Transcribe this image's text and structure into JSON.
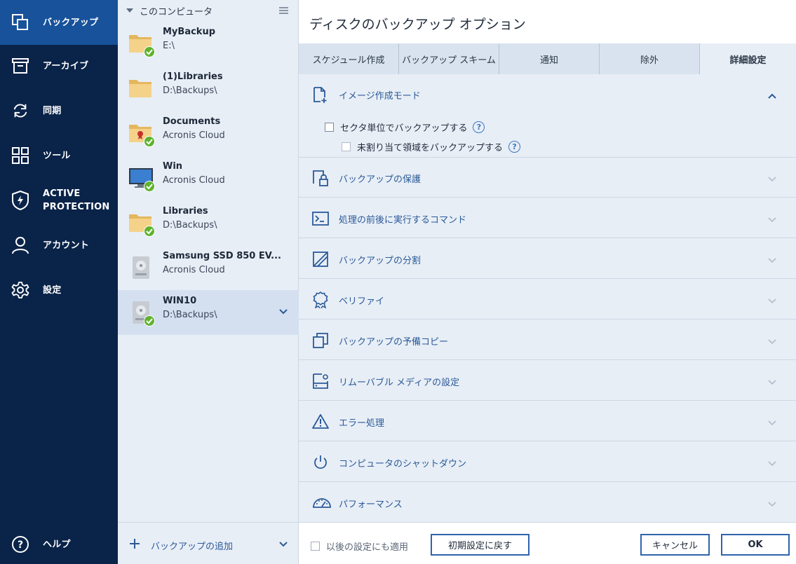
{
  "nav": {
    "items": [
      {
        "label": "バックアップ",
        "icon": "copy-icon"
      },
      {
        "label": "アーカイブ",
        "icon": "archive-icon"
      },
      {
        "label": "同期",
        "icon": "sync-icon"
      },
      {
        "label": "ツール",
        "icon": "tools-icon"
      },
      {
        "label": "ACTIVE PROTECTION",
        "icon": "shield-icon"
      },
      {
        "label": "アカウント",
        "icon": "account-icon"
      },
      {
        "label": "設定",
        "icon": "gear-icon"
      }
    ],
    "help_label": "ヘルプ",
    "accent": "#17529b",
    "background": "#0a2348"
  },
  "list": {
    "header": "このコンピュータ",
    "items": [
      {
        "name": "MyBackup",
        "sub": "E:\\",
        "type": "folder",
        "ok": true
      },
      {
        "name": "(1)Libraries",
        "sub": "D:\\Backups\\",
        "type": "folder",
        "ok": false
      },
      {
        "name": "Documents",
        "sub": "Acronis Cloud",
        "type": "folder-secure",
        "ok": true
      },
      {
        "name": "Win",
        "sub": "Acronis Cloud",
        "type": "monitor",
        "ok": true
      },
      {
        "name": "Libraries",
        "sub": "D:\\Backups\\",
        "type": "folder",
        "ok": true
      },
      {
        "name": "Samsung SSD 850 EV...",
        "sub": "Acronis Cloud",
        "type": "disk",
        "ok": false
      },
      {
        "name": "WIN10",
        "sub": "D:\\Backups\\",
        "type": "disk",
        "ok": true
      }
    ],
    "add_label": "バックアップの追加"
  },
  "pane": {
    "title": "ディスクのバックアップ オプション",
    "tabs": [
      "スケジュール作成",
      "バックアップ スキーム",
      "通知",
      "除外",
      "詳細設定"
    ],
    "active_tab": 4,
    "options": [
      {
        "label": "イメージ作成モード",
        "icon": "file-plus-icon"
      },
      {
        "label": "バックアップの保護",
        "icon": "lock-icon"
      },
      {
        "label": "処理の前後に実行するコマンド",
        "icon": "terminal-icon"
      },
      {
        "label": "バックアップの分割",
        "icon": "split-icon"
      },
      {
        "label": "ベリファイ",
        "icon": "badge-icon"
      },
      {
        "label": "バックアップの予備コピー",
        "icon": "duplicate-icon"
      },
      {
        "label": "リムーバブル メディアの設定",
        "icon": "removable-media-icon"
      },
      {
        "label": "エラー処理",
        "icon": "warning-icon"
      },
      {
        "label": "コンピュータのシャットダウン",
        "icon": "power-icon"
      },
      {
        "label": "パフォーマンス",
        "icon": "gauge-icon"
      }
    ],
    "sector_backup": "セクタ単位でバックアップする",
    "unallocated_backup": "未割り当て領域をバックアップする",
    "help_glyph": "?"
  },
  "footer": {
    "apply_label": "以後の設定にも適用",
    "reset_label": "初期設定に戻す",
    "cancel_label": "キャンセル",
    "ok_label": "OK"
  }
}
